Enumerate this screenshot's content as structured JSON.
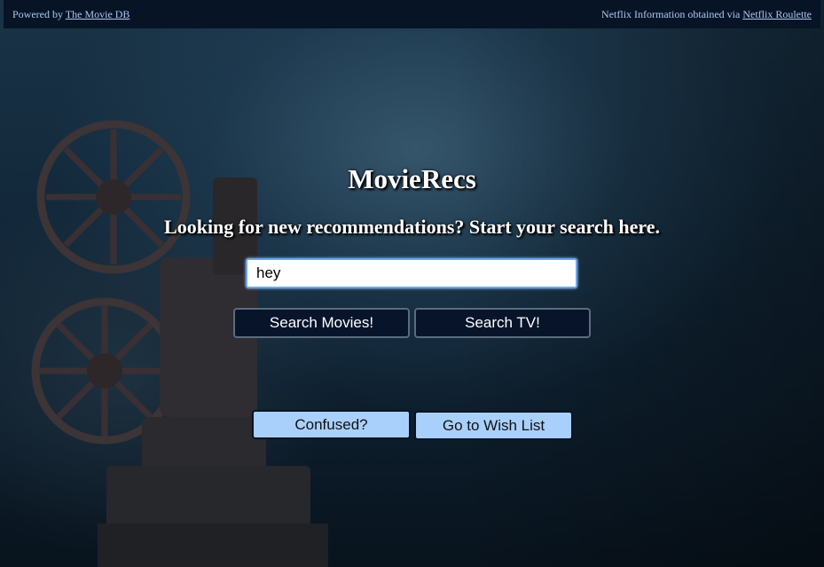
{
  "header": {
    "left_prefix": "Powered by ",
    "left_link": "The Movie DB",
    "right_prefix": "Netflix Information obtained via ",
    "right_link": "Netflix Roulette"
  },
  "main": {
    "title": "MovieRecs",
    "subtitle": "Looking for new recommendations? Start your search here.",
    "search_value": "hey",
    "search_movies_label": "Search Movies!",
    "search_tv_label": "Search TV!",
    "confused_label": "Confused?",
    "wishlist_label": "Go to Wish List"
  },
  "colors": {
    "header_bg": "#071426",
    "link": "#a9c8f0",
    "dark_button": "#07142a",
    "light_button": "#a9d0fb",
    "input_focus": "#6fa6e6"
  }
}
